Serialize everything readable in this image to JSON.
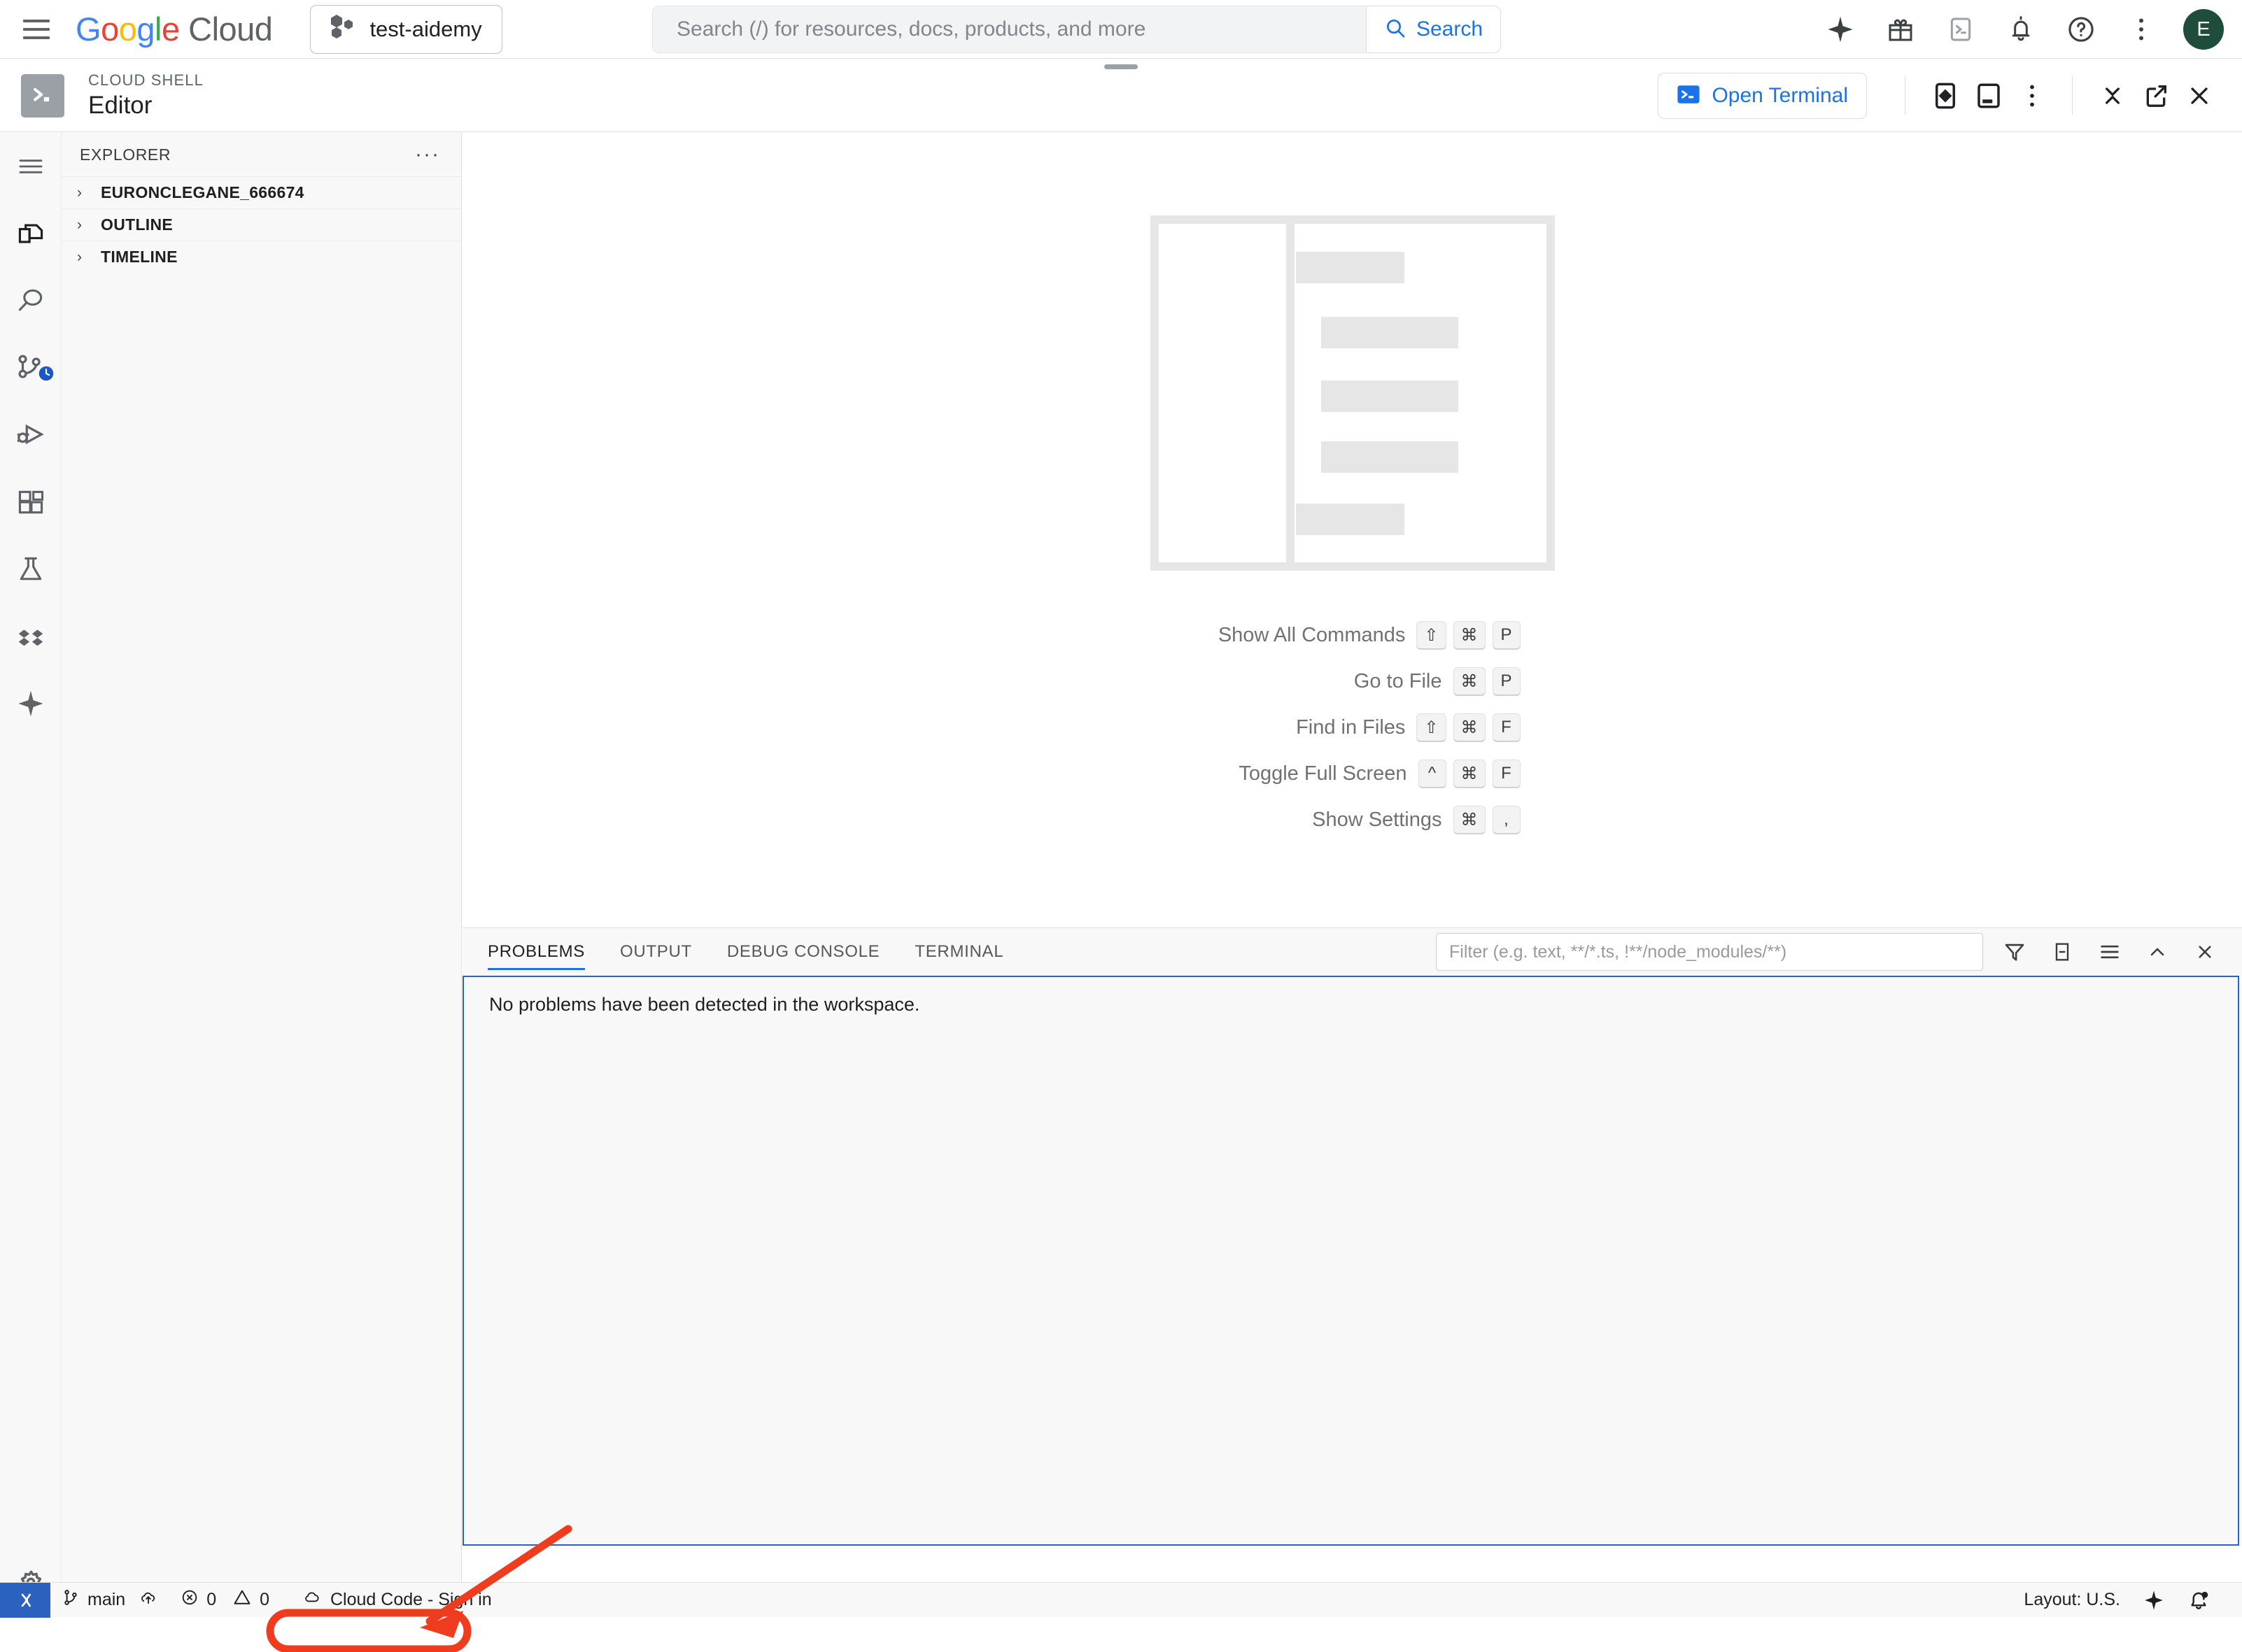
{
  "gcp_bar": {
    "menu_icon": "hamburger-icon",
    "logo": {
      "g1": "G",
      "o1": "o",
      "o2": "o",
      "g2": "g",
      "l": "l",
      "e": "e",
      "cloud": " Cloud"
    },
    "project": {
      "name": "test-aidemy",
      "icon": "project-hexagons-icon"
    },
    "search": {
      "placeholder": "Search (/) for resources, docs, products, and more",
      "value": "",
      "button_label": "Search",
      "icon": "search-icon"
    },
    "icons": [
      "gemini-sparkle-icon",
      "gift-icon",
      "cloud-shell-icon",
      "notifications-bell-icon",
      "help-question-icon",
      "more-vertical-icon"
    ],
    "avatar_letter": "E"
  },
  "cloud_shell": {
    "kicker": "CLOUD SHELL",
    "title": "Editor",
    "logo_icon": "cloud-shell-terminal-icon",
    "open_terminal_label": "Open Terminal",
    "open_terminal_icon": "terminal-prompt-icon",
    "actions": [
      "preview-on-web-icon",
      "new-editor-window-icon",
      "more-vertical-icon",
      "minimize-chevrons-icon",
      "open-new-window-icon",
      "close-x-icon"
    ]
  },
  "activity_bar": {
    "items": [
      {
        "name": "menu-lines-icon",
        "label": "Menu"
      },
      {
        "name": "explorer-files-icon",
        "label": "Explorer"
      },
      {
        "name": "search-magnifier-icon",
        "label": "Search"
      },
      {
        "name": "source-control-icon",
        "label": "Source Control"
      },
      {
        "name": "run-and-debug-icon",
        "label": "Run and Debug"
      },
      {
        "name": "extensions-icon",
        "label": "Extensions"
      },
      {
        "name": "testing-flask-icon",
        "label": "Testing"
      },
      {
        "name": "cloud-code-icon",
        "label": "Cloud Code"
      },
      {
        "name": "gemini-sparkle-icon",
        "label": "Gemini Code Assist"
      }
    ],
    "gear": {
      "name": "settings-gear-icon",
      "label": "Manage"
    }
  },
  "explorer": {
    "header": "EXPLORER",
    "more_actions": "···",
    "sections": [
      {
        "label": "EURONCLEGANE_666674",
        "expanded": false
      },
      {
        "label": "OUTLINE",
        "expanded": false
      },
      {
        "label": "TIMELINE",
        "expanded": false
      }
    ]
  },
  "welcome": {
    "shortcuts": [
      {
        "label": "Show All Commands",
        "keys": [
          "⇧",
          "⌘",
          "P"
        ]
      },
      {
        "label": "Go to File",
        "keys": [
          "⌘",
          "P"
        ]
      },
      {
        "label": "Find in Files",
        "keys": [
          "⇧",
          "⌘",
          "F"
        ]
      },
      {
        "label": "Toggle Full Screen",
        "keys": [
          "^",
          "⌘",
          "F"
        ]
      },
      {
        "label": "Show Settings",
        "keys": [
          "⌘",
          ","
        ]
      }
    ]
  },
  "panel": {
    "tabs": [
      {
        "label": "PROBLEMS",
        "active": true
      },
      {
        "label": "OUTPUT",
        "active": false
      },
      {
        "label": "DEBUG CONSOLE",
        "active": false
      },
      {
        "label": "TERMINAL",
        "active": false
      }
    ],
    "filter": {
      "placeholder": "Filter (e.g. text, **/*.ts, !**/node_modules/**)",
      "value": ""
    },
    "actions": [
      "filter-funnel-icon",
      "collapse-all-icon",
      "view-as-table-icon",
      "chevron-up-icon",
      "close-x-icon"
    ],
    "message": "No problems have been detected in the workspace."
  },
  "status_bar": {
    "remote_icon": "remote-window-icon",
    "branch": {
      "icon": "source-control-branch-icon",
      "label": "main",
      "sync_icon": "sync-cloud-up-icon"
    },
    "errors": {
      "icon": "error-circle-icon",
      "count": "0"
    },
    "warnings": {
      "icon": "warning-triangle-icon",
      "count": "0"
    },
    "cloud_code": {
      "icon": "cloud-code-icon",
      "label": "Cloud Code - Sign in"
    },
    "layout": "Layout: U.S.",
    "right_icons": [
      "gemini-sparkle-icon",
      "notifications-bell-dot-icon"
    ]
  },
  "annotation": {
    "highlight_target": "Cloud Code - Sign in",
    "color": "#f03c1e",
    "shape": "arrow-and-ellipse"
  },
  "colors": {
    "accent_blue": "#1a73e8",
    "panel_border_blue": "#2b62c0",
    "status_remote_blue": "#2b62c0",
    "annotation_red": "#f03c1e",
    "avatar_green": "#1e4d3b",
    "sidebar_bg": "#f8f8f8"
  }
}
